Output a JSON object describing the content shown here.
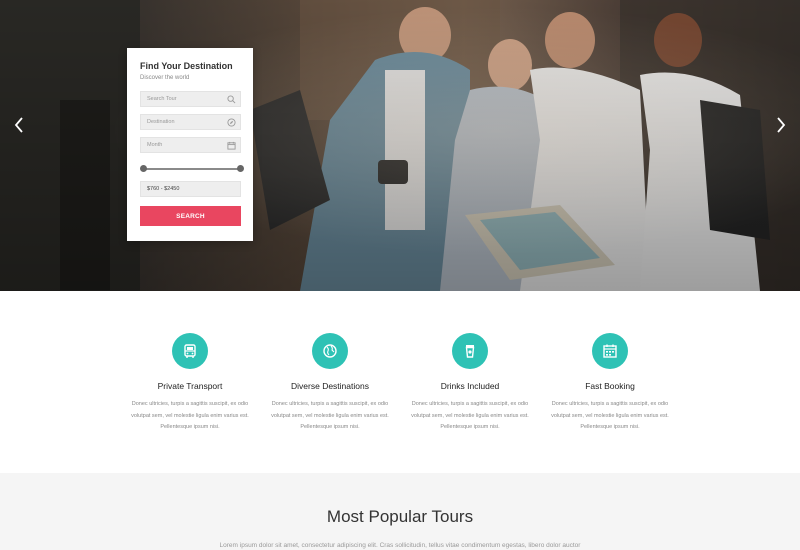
{
  "hero": {
    "prev_label": "‹",
    "next_label": "›"
  },
  "search": {
    "title": "Find Your Destination",
    "subtitle": "Discover the world",
    "tour_placeholder": "Search Tour",
    "destination_placeholder": "Destination",
    "month_placeholder": "Month",
    "price_range": "$760 - $2450",
    "button_label": "SEARCH"
  },
  "features": [
    {
      "icon": "bus-icon",
      "title": "Private Transport",
      "text": "Donec ultricies, turpis a sagittis suscipit, ex odio volutpat sem, vel molestie ligula enim varius est. Pellentesque ipsum nisi."
    },
    {
      "icon": "globe-icon",
      "title": "Diverse Destinations",
      "text": "Donec ultricies, turpis a sagittis suscipit, ex odio volutpat sem, vel molestie ligula enim varius est. Pellentesque ipsum nisi."
    },
    {
      "icon": "cup-icon",
      "title": "Drinks Included",
      "text": "Donec ultricies, turpis a sagittis suscipit, ex odio volutpat sem, vel molestie ligula enim varius est. Pellentesque ipsum nisi."
    },
    {
      "icon": "calendar-icon",
      "title": "Fast Booking",
      "text": "Donec ultricies, turpis a sagittis suscipit, ex odio volutpat sem, vel molestie ligula enim varius est. Pellentesque ipsum nisi."
    }
  ],
  "tours": {
    "title": "Most Popular Tours",
    "intro": "Lorem ipsum dolor sit amet, consectetur adipiscing elit. Cras sollicitudin, tellus vitae condimentum egestas, libero dolor auctor"
  },
  "colors": {
    "accent_teal": "#2ec2b5",
    "button_red": "#e94660"
  }
}
